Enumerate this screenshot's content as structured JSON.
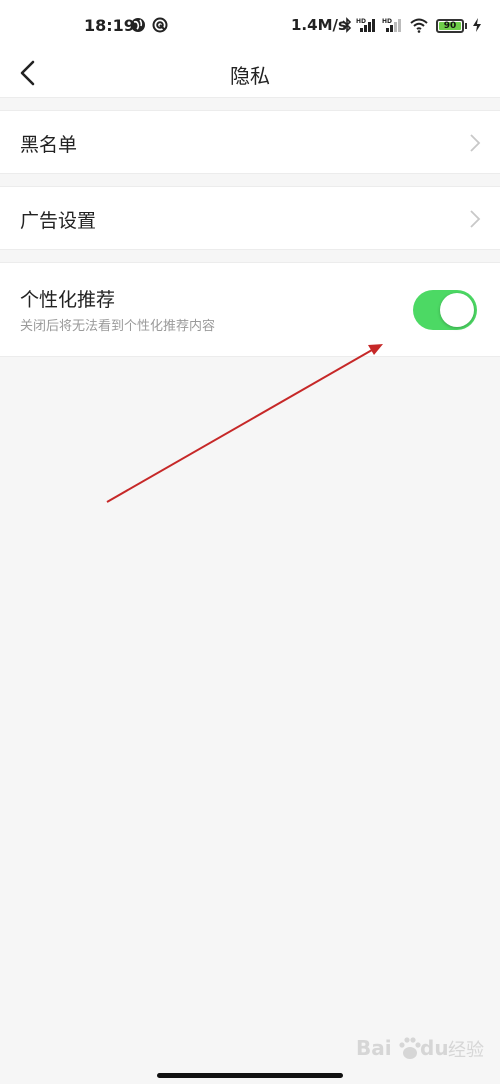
{
  "status_bar": {
    "time": "18:19",
    "speed": "1.4M/s",
    "battery": "90",
    "icons": [
      "globe-icon",
      "app-notification-icon",
      "bluetooth-icon",
      "hd-signal-icon",
      "hd-signal-icon",
      "wifi-icon",
      "battery-icon",
      "charging-icon"
    ]
  },
  "nav": {
    "title": "隐私",
    "back_icon": "chevron-left-icon"
  },
  "rows": [
    {
      "label": "黑名单",
      "chevron_icon": "chevron-right-icon"
    },
    {
      "label": "广告设置",
      "chevron_icon": "chevron-right-icon"
    }
  ],
  "personalized": {
    "label": "个性化推荐",
    "sub_label": "关闭后将无法看到个性化推荐内容",
    "enabled": true
  },
  "colors": {
    "toggle_on": "#4cd964",
    "annotation_arrow": "#c62828",
    "background": "#f6f6f6"
  },
  "watermark": {
    "text": "Bai du 经验",
    "icon": "baidu-paw-logo"
  }
}
